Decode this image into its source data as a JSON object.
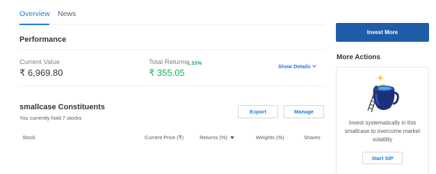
{
  "tabs": [
    {
      "label": "Overview",
      "active": true
    },
    {
      "label": "News",
      "active": false
    }
  ],
  "performance": {
    "title": "Performance",
    "current_value_label": "Current Value",
    "current_value": "₹ 6,969.80",
    "total_returns_label": "Total Returns",
    "total_returns_pct": "1.33%",
    "total_returns_value": "₹ 355.05",
    "show_details_label": "Show Details"
  },
  "constituents": {
    "title": "smallcase Constituents",
    "subtitle": "You currently hold 7 stocks",
    "export_label": "Export",
    "manage_label": "Manage",
    "columns": [
      "Stock",
      "Current Price (₹)",
      "Returns (%)",
      "Weights (%)",
      "Shares"
    ]
  },
  "sidebar": {
    "invest_more_label": "Invest More",
    "more_actions_title": "More Actions",
    "sip_text": "Invest systematically in this smallcase to overcome market volatility",
    "start_sip_label": "Start SIP",
    "illustration_icon": "sip-jar-ladder-illustration"
  },
  "colors": {
    "accent": "#1f7ae0",
    "primary_button": "#1f5ca8",
    "positive": "#19af55"
  }
}
